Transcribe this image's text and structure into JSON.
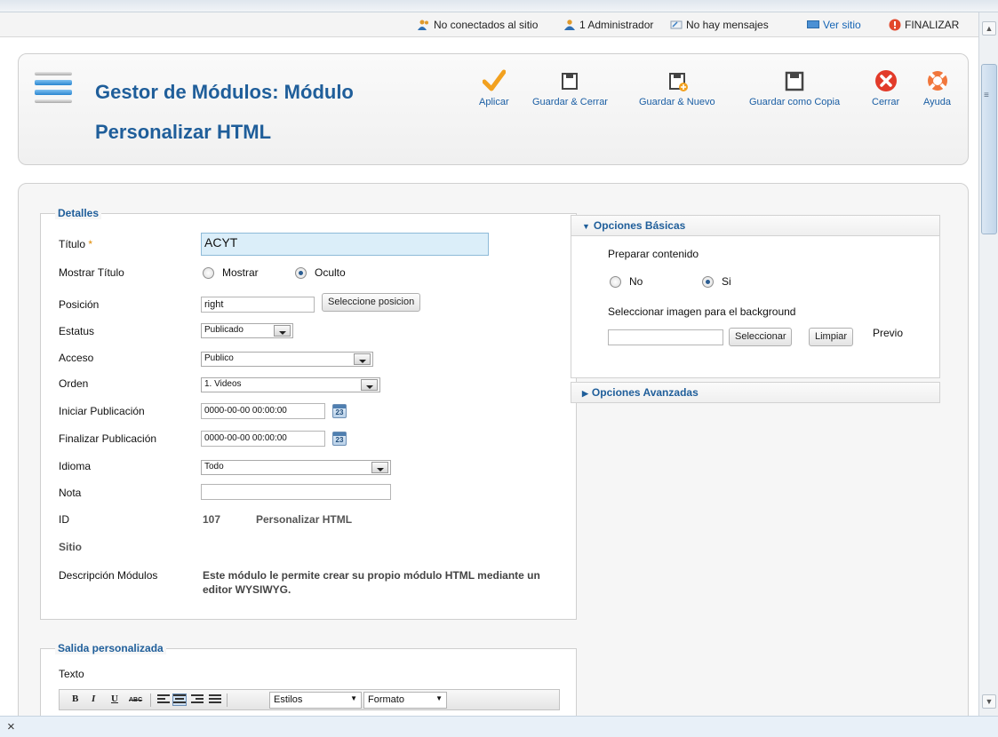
{
  "statusbar": {
    "offline": "No conectados al sitio",
    "admin": "1 Administrador",
    "messages": "No hay mensajes",
    "view_site": "Ver sitio",
    "logout": "FINALIZAR"
  },
  "header": {
    "title": "Gestor de Módulos: Módulo Personalizar HTML",
    "toolbar": {
      "apply": "Aplicar",
      "save_close": "Guardar & Cerrar",
      "save_new": "Guardar & Nuevo",
      "save_copy": "Guardar como Copia",
      "close": "Cerrar",
      "help": "Ayuda"
    }
  },
  "details": {
    "legend": "Detalles",
    "title_label": "Título",
    "title_value": "ACYT",
    "show_title_label": "Mostrar Título",
    "show_option": "Mostrar",
    "hide_option": "Oculto",
    "position_label": "Posición",
    "position_value": "right",
    "position_button": "Seleccione posicion",
    "status_label": "Estatus",
    "status_value": "Publicado",
    "access_label": "Acceso",
    "access_value": "Publico",
    "order_label": "Orden",
    "order_value": "1. Videos",
    "start_label": "Iniciar Publicación",
    "start_value": "0000-00-00 00:00:00",
    "finish_label": "Finalizar Publicación",
    "finish_value": "0000-00-00 00:00:00",
    "language_label": "Idioma",
    "language_value": "Todo",
    "note_label": "Nota",
    "note_value": "",
    "id_label": "ID",
    "id_value": "107",
    "module_type": "Personalizar HTML",
    "site_label": "Sitio",
    "description_label": "Descripción Módulos",
    "description_text": "Este módulo le permite crear su propio módulo HTML mediante un editor WYSIWYG."
  },
  "basic_options": {
    "header": "Opciones Básicas",
    "prepare_label": "Preparar contenido",
    "no_option": "No",
    "yes_option": "Si",
    "bg_label": "Seleccionar imagen para el background",
    "bg_value": "",
    "select_button": "Seleccionar",
    "clear_button": "Limpiar",
    "preview_label": "Previo"
  },
  "advanced_options": {
    "header": "Opciones Avanzadas"
  },
  "custom_output": {
    "legend": "Salida personalizada",
    "text_label": "Texto",
    "editor": {
      "bold": "B",
      "italic": "I",
      "underline": "U",
      "strike": "ABC",
      "styles": "Estilos",
      "format": "Formato"
    }
  },
  "bottom": {
    "close_glyph": "×"
  },
  "colors": {
    "title_blue": "#1f5e9a",
    "link_blue": "#1665b5",
    "apply_orange": "#f2a11f",
    "close_red": "#e23b2a"
  }
}
